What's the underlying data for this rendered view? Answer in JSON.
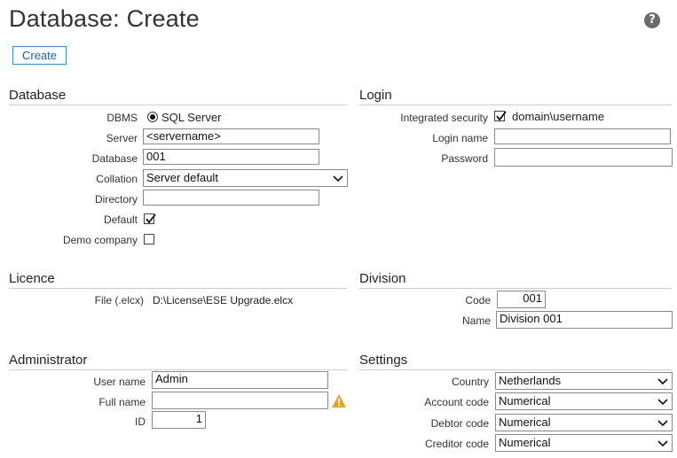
{
  "page": {
    "title": "Database: Create",
    "help_glyph": "?"
  },
  "toolbar": {
    "create_label": "Create"
  },
  "database": {
    "heading": "Database",
    "dbms_label": "DBMS",
    "dbms_value": "SQL Server",
    "server_label": "Server",
    "server_value": "<servername>",
    "database_label": "Database",
    "database_value": "001",
    "collation_label": "Collation",
    "collation_value": "Server default",
    "directory_label": "Directory",
    "directory_value": "",
    "default_label": "Default",
    "default_checked": true,
    "demo_label": "Demo company",
    "demo_checked": false
  },
  "login": {
    "heading": "Login",
    "integrated_label": "Integrated security",
    "integrated_checked": true,
    "integrated_user": "domain\\username",
    "loginname_label": "Login name",
    "loginname_value": "",
    "password_label": "Password",
    "password_value": ""
  },
  "licence": {
    "heading": "Licence",
    "file_label": "File (.elcx)",
    "file_value": "D:\\License\\ESE Upgrade.elcx"
  },
  "division": {
    "heading": "Division",
    "code_label": "Code",
    "code_value": "001",
    "name_label": "Name",
    "name_value": "Division 001"
  },
  "administrator": {
    "heading": "Administrator",
    "username_label": "User name",
    "username_value": "Admin",
    "fullname_label": "Full name",
    "fullname_value": "",
    "id_label": "ID",
    "id_value": "1"
  },
  "settings": {
    "heading": "Settings",
    "country_label": "Country",
    "country_value": "Netherlands",
    "account_label": "Account code",
    "account_value": "Numerical",
    "debtor_label": "Debtor code",
    "debtor_value": "Numerical",
    "creditor_label": "Creditor code",
    "creditor_value": "Numerical"
  },
  "colors": {
    "accent": "#3a8fd6",
    "warning": "#f0a21b",
    "rule": "#cfcfcf"
  }
}
